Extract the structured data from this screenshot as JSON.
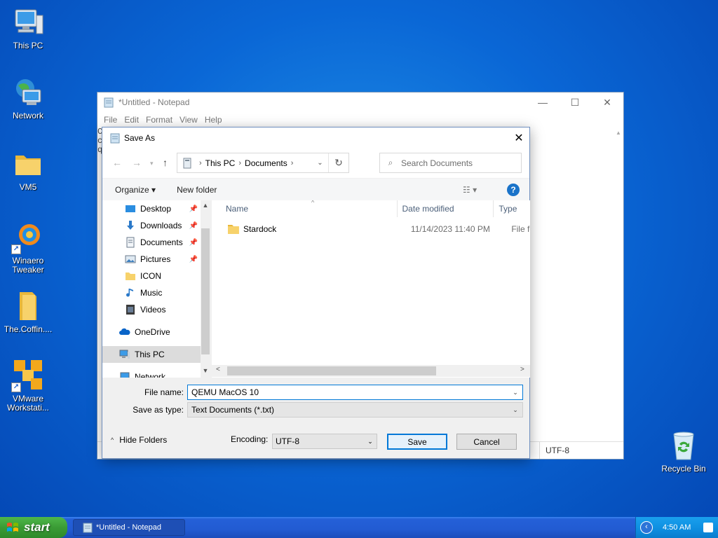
{
  "desktop": {
    "icons": [
      {
        "label": "This PC"
      },
      {
        "label": "Network"
      },
      {
        "label": "VM5"
      },
      {
        "label": "Winaero\nTweaker"
      },
      {
        "label": "The.Coffin...."
      },
      {
        "label": "VMware\nWorkstati..."
      }
    ],
    "recycle_bin": "Recycle Bin"
  },
  "notepad": {
    "title": "*Untitled - Notepad",
    "menu": [
      "File",
      "Edit",
      "Format",
      "View",
      "Help"
    ],
    "text_fragments": [
      "C",
      "c",
      "q"
    ],
    "status_encoding": "UTF-8"
  },
  "save_dialog": {
    "title": "Save As",
    "breadcrumb": [
      "This PC",
      "Documents"
    ],
    "search_placeholder": "Search Documents",
    "organize_label": "Organize",
    "new_folder_label": "New folder",
    "help_label": "?",
    "nav_items": [
      {
        "label": "Desktop",
        "pinned": true
      },
      {
        "label": "Downloads",
        "pinned": true
      },
      {
        "label": "Documents",
        "pinned": true
      },
      {
        "label": "Pictures",
        "pinned": true
      },
      {
        "label": "ICON",
        "pinned": false
      },
      {
        "label": "Music",
        "pinned": false
      },
      {
        "label": "Videos",
        "pinned": false
      },
      {
        "label": "OneDrive",
        "pinned": false
      },
      {
        "label": "This PC",
        "pinned": false,
        "selected": true
      },
      {
        "label": "Network",
        "pinned": false
      }
    ],
    "columns": {
      "name": "Name",
      "date": "Date modified",
      "type": "Type"
    },
    "files": [
      {
        "name": "Stardock",
        "date": "11/14/2023 11:40 PM",
        "type": "File fo"
      }
    ],
    "file_name_label": "File name:",
    "file_name_value": "QEMU MacOS 10",
    "save_type_label": "Save as type:",
    "save_type_value": "Text Documents (*.txt)",
    "hide_folders_label": "Hide Folders",
    "encoding_label": "Encoding:",
    "encoding_value": "UTF-8",
    "save_button": "Save",
    "cancel_button": "Cancel"
  },
  "taskbar": {
    "start_label": "start",
    "task_button": "*Untitled - Notepad",
    "clock": "4:50 AM"
  },
  "colors": {
    "desktop_bg": "#0a67d6",
    "taskbar": "#225bd2",
    "start_green": "#3a9b35",
    "accent": "#0078d7"
  }
}
